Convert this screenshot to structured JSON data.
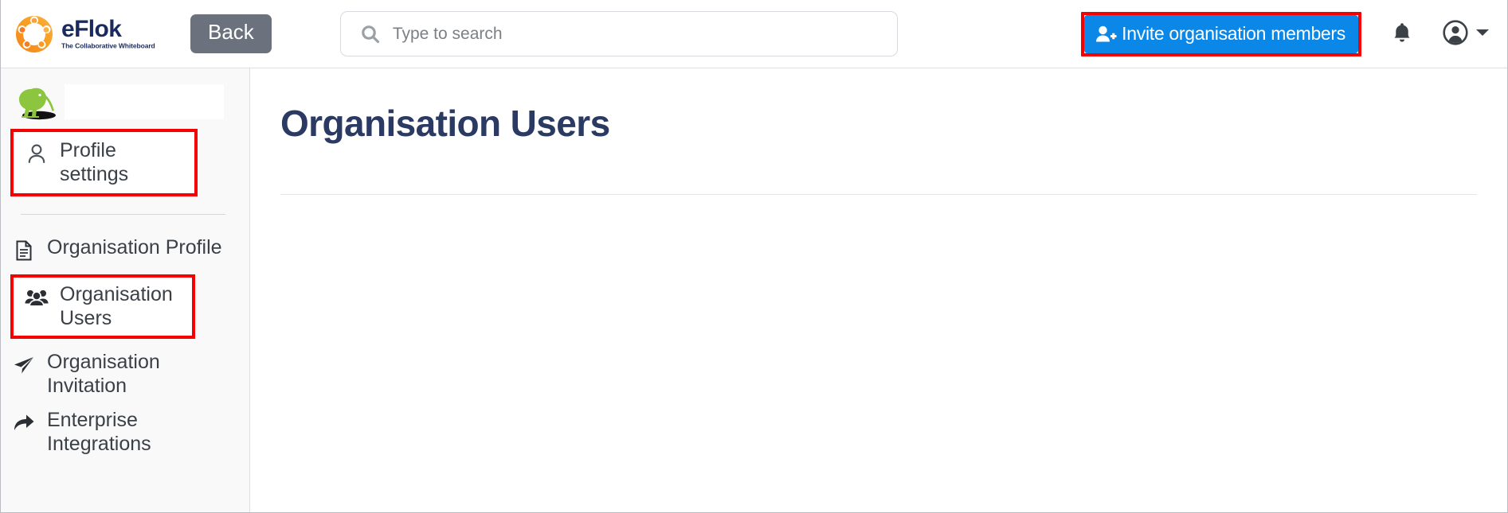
{
  "header": {
    "brand": {
      "name": "eFlok",
      "tagline": "The Collaborative Whiteboard",
      "logo_icon": "eflok-circle-people-logo",
      "colors": {
        "text": "#1b2a5e",
        "logo_orange": "#f47c20",
        "logo_yellow": "#fbb040"
      }
    },
    "back_label": "Back",
    "search": {
      "placeholder": "Type to search",
      "value": "",
      "icon": "search-icon"
    },
    "invite_button": {
      "label": "Invite organisation members",
      "icon": "user-plus-icon",
      "color": "#0b87e8",
      "highlight_color": "#f40000"
    },
    "notifications_icon": "bell-icon",
    "account_icon": "user-circle-icon",
    "account_chevron_icon": "chevron-down-icon"
  },
  "sidebar": {
    "profile": {
      "avatar_icon": "kiwi-bird-avatar",
      "display_name": "",
      "name_redacted": true
    },
    "profile_settings": {
      "label": "Profile settings",
      "icon": "user-outline-icon",
      "highlighted": true
    },
    "items": [
      {
        "label": "Organisation Profile",
        "icon": "document-icon",
        "highlighted": false
      },
      {
        "label": "Organisation Users",
        "icon": "users-group-icon",
        "highlighted": true
      },
      {
        "label": "Organisation Invitation",
        "icon": "paper-plane-icon",
        "highlighted": false
      },
      {
        "label": "Enterprise Integrations",
        "icon": "arrow-share-icon",
        "highlighted": false
      }
    ]
  },
  "main": {
    "page_title": "Organisation Users",
    "title_color": "#2b3a63"
  }
}
